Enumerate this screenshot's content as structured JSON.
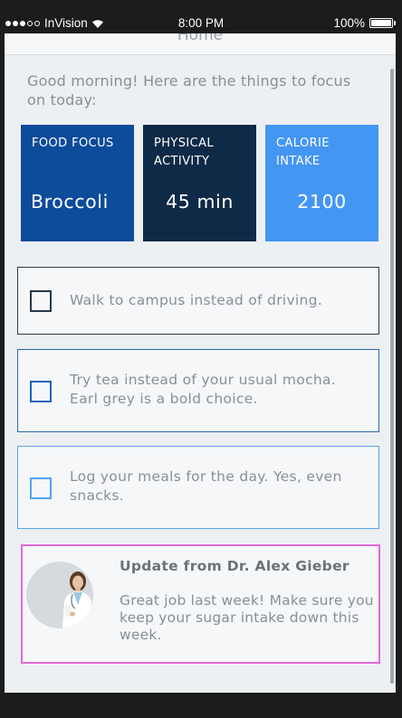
{
  "status_bar": {
    "carrier": "InVision",
    "time": "8:00 PM",
    "battery": "100%",
    "battery_level": 1.0,
    "signal_bars_filled": 3,
    "signal_bars_total": 5
  },
  "header": {
    "title": "Home"
  },
  "greeting": "Good morning! Here are the things to focus on today:",
  "tiles": [
    {
      "label": "FOOD FOCUS",
      "value": "Broccoli",
      "color": "#0d4b9b"
    },
    {
      "label": "PHYSICAL ACTIVITY",
      "value": "45 min",
      "color": "#0e2a47"
    },
    {
      "label": "CALORIE INTAKE",
      "value": "2100",
      "color": "#4496f3"
    }
  ],
  "tasks": [
    {
      "text": "Walk to campus instead of driving.",
      "checked": false,
      "color": "#263849"
    },
    {
      "text": "Try tea instead of your usual mocha. Earl grey is a bold choice.",
      "checked": false,
      "color": "#1b63b9"
    },
    {
      "text": "Log your meals for the day. Yes, even snacks.",
      "checked": false,
      "color": "#57a3f1"
    }
  ],
  "update": {
    "title": "Update from Dr. Alex Gieber",
    "body": "Great job last week! Make sure you keep your sugar intake down this week.",
    "border_color": "#e36ad9"
  },
  "icons": {
    "signal": "signal-dots-icon",
    "wifi": "wifi-icon",
    "battery": "battery-icon",
    "checkbox": "checkbox-icon",
    "avatar": "doctor-avatar"
  }
}
